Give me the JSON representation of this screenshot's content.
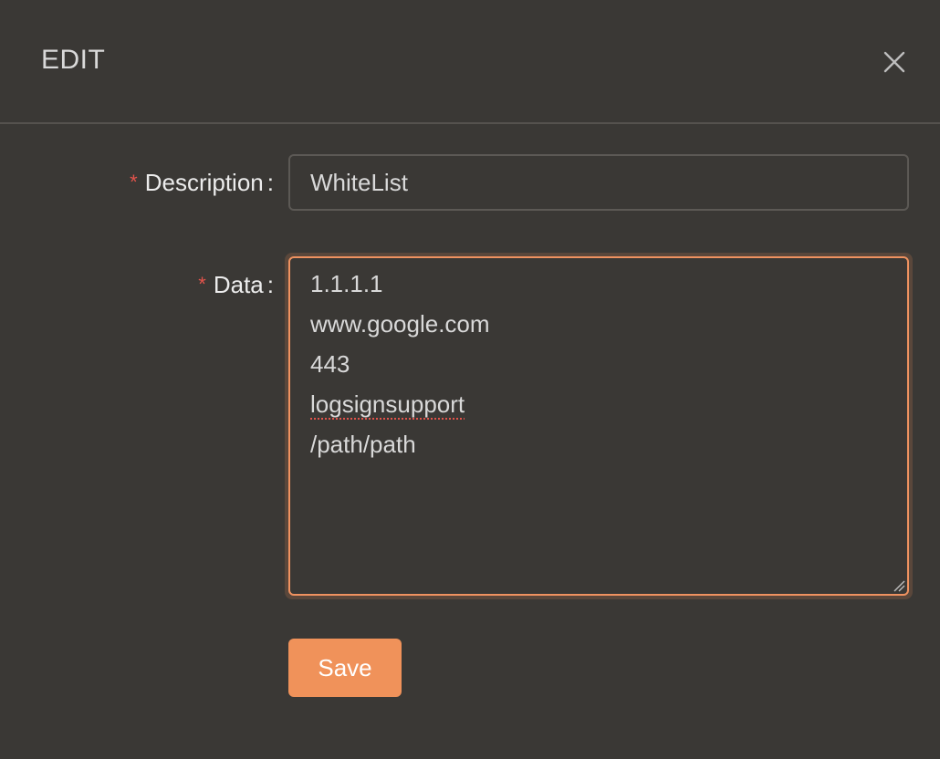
{
  "dialog": {
    "title": "EDIT",
    "close_icon": "close-icon"
  },
  "form": {
    "description": {
      "required_mark": "*",
      "label": "Description",
      "colon": ":",
      "value": "WhiteList"
    },
    "data": {
      "required_mark": "*",
      "label": "Data",
      "colon": ":",
      "lines": [
        "1.1.1.1",
        "www.google.com",
        "443",
        "logsignsupport",
        "/path/path"
      ]
    }
  },
  "actions": {
    "save_label": "Save"
  },
  "colors": {
    "background": "#3a3835",
    "accent": "#f0925a",
    "required": "#e2534b"
  }
}
